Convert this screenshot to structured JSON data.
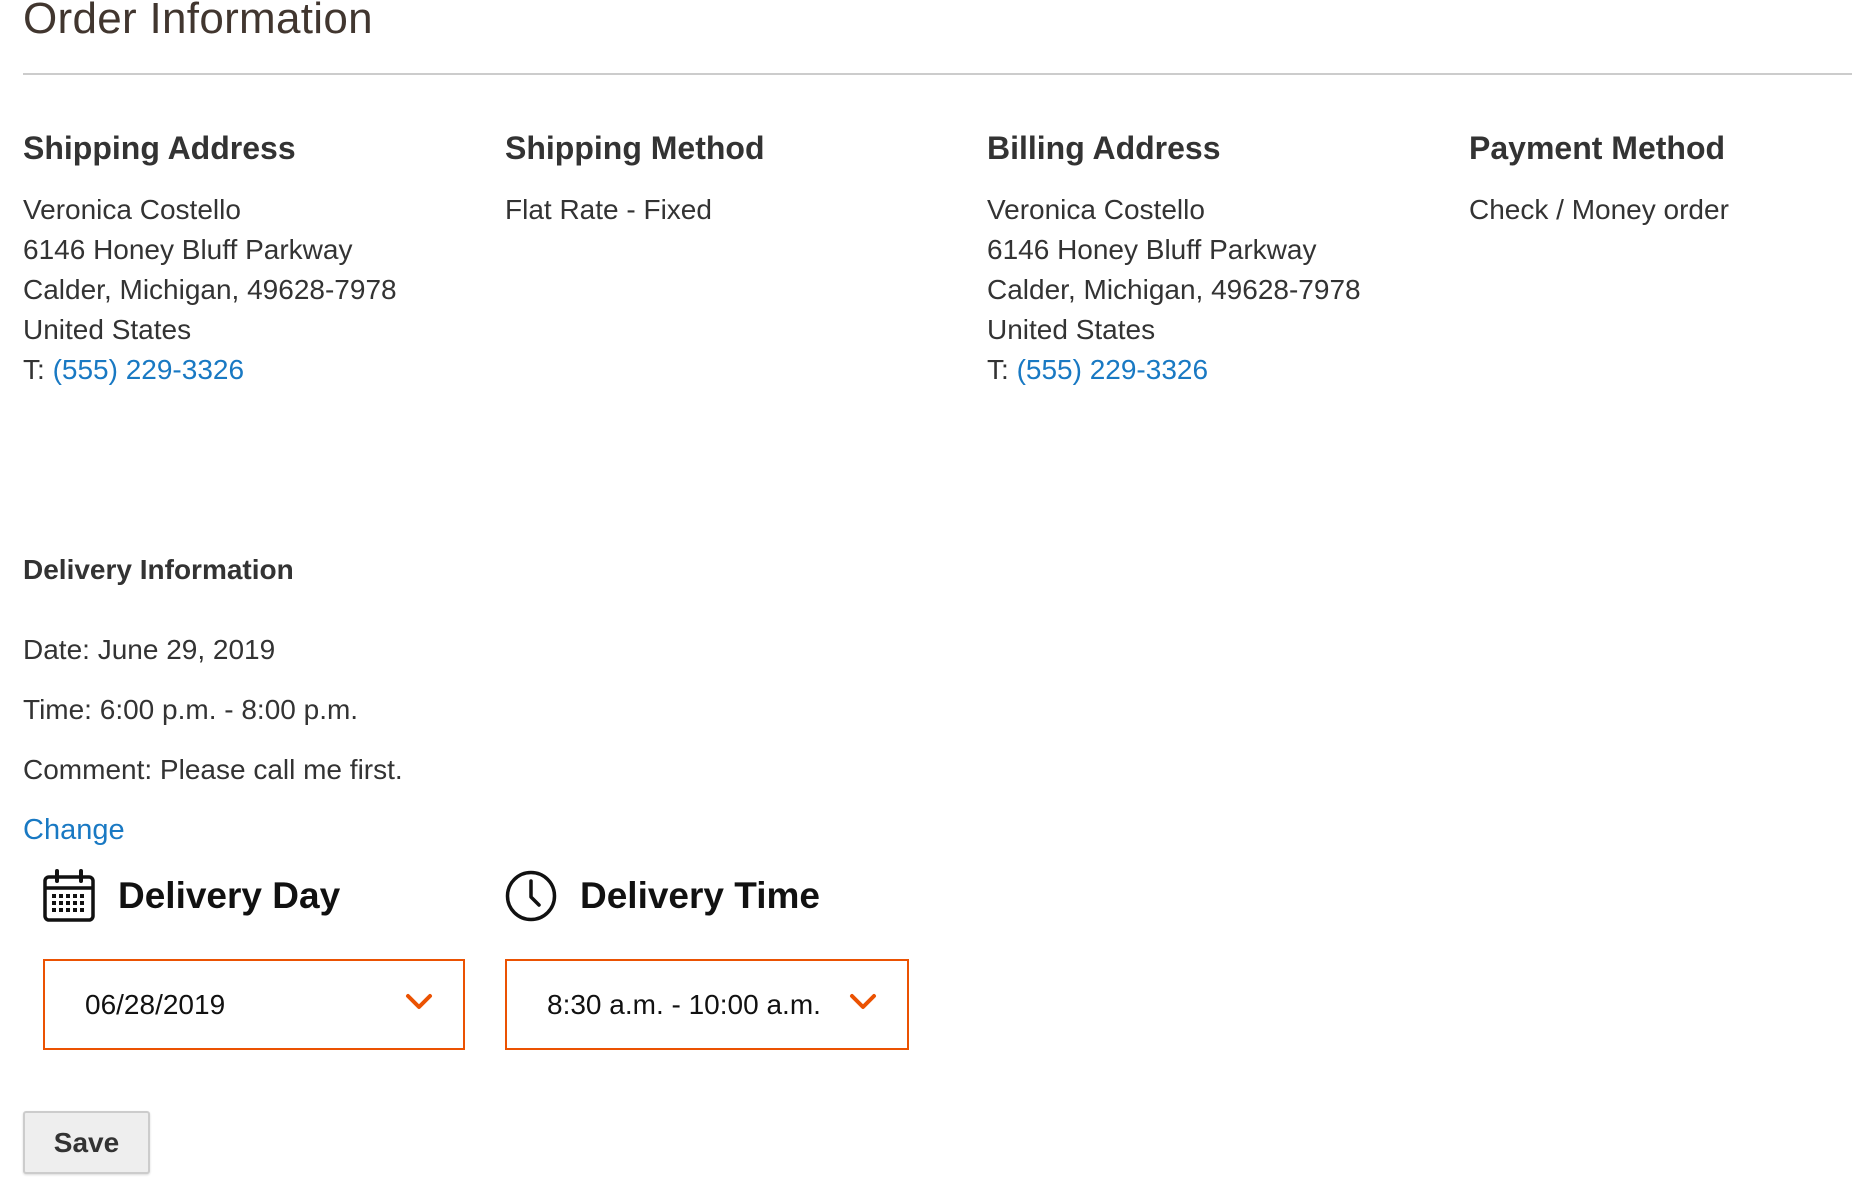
{
  "page": {
    "title": "Order Information"
  },
  "shipping_address": {
    "heading": "Shipping Address",
    "name": "Veronica Costello",
    "street": "6146 Honey Bluff Parkway",
    "city_line": "Calder, Michigan, 49628-7978",
    "country": "United States",
    "phone_prefix": "T: ",
    "phone": "(555) 229-3326"
  },
  "shipping_method": {
    "heading": "Shipping Method",
    "value": "Flat Rate - Fixed"
  },
  "billing_address": {
    "heading": "Billing Address",
    "name": "Veronica Costello",
    "street": "6146 Honey Bluff Parkway",
    "city_line": "Calder, Michigan, 49628-7978",
    "country": "United States",
    "phone_prefix": "T: ",
    "phone": "(555) 229-3326"
  },
  "payment_method": {
    "heading": "Payment Method",
    "value": "Check / Money order"
  },
  "delivery_info": {
    "heading": "Delivery Information",
    "date_line": "Date: June 29, 2019",
    "time_line": "Time: 6:00 p.m. - 8:00 p.m.",
    "comment_line": "Comment: Please call me first.",
    "change_label": "Change"
  },
  "delivery_day": {
    "label": "Delivery Day",
    "icon": "calendar-icon",
    "selected_value": "06/28/2019"
  },
  "delivery_time": {
    "label": "Delivery Time",
    "icon": "clock-icon",
    "selected_value": "8:30 a.m. - 10:00 a.m."
  },
  "actions": {
    "save_label": "Save"
  },
  "colors": {
    "link": "#1979c3",
    "accent": "#eb5202",
    "text": "#333333"
  }
}
